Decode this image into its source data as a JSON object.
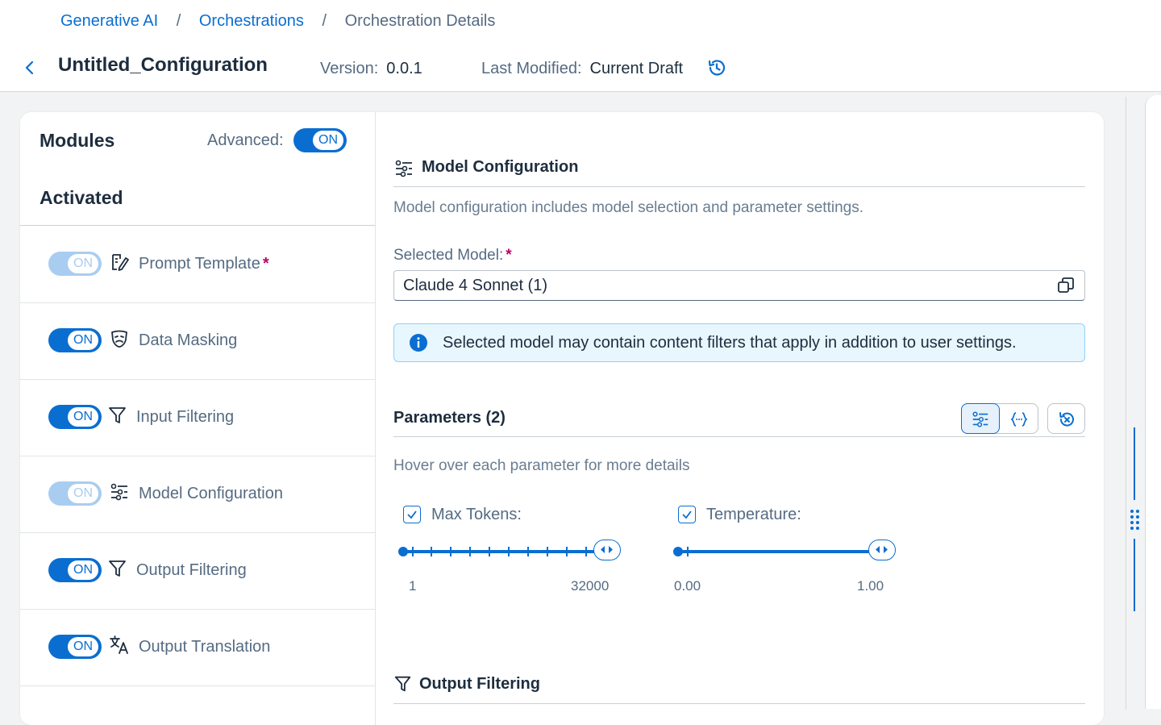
{
  "breadcrumb": {
    "items": [
      "Generative AI",
      "Orchestrations",
      "Orchestration Details"
    ],
    "separator": "/"
  },
  "header": {
    "title": "Untitled_Configuration",
    "version_label": "Version:",
    "version_value": "0.0.1",
    "modified_label": "Last Modified:",
    "modified_value": "Current Draft"
  },
  "modules": {
    "title": "Modules",
    "advanced_label": "Advanced:",
    "advanced_toggle": "ON",
    "activated_title": "Activated",
    "items": [
      {
        "label": "Prompt Template",
        "toggle": "ON",
        "required": "*",
        "disabled": true,
        "icon": "prompt-edit-icon"
      },
      {
        "label": "Data Masking",
        "toggle": "ON",
        "disabled": false,
        "icon": "mask-icon"
      },
      {
        "label": "Input Filtering",
        "toggle": "ON",
        "disabled": false,
        "icon": "filter-icon"
      },
      {
        "label": "Model Configuration",
        "toggle": "ON",
        "disabled": true,
        "icon": "sliders-icon"
      },
      {
        "label": "Output Filtering",
        "toggle": "ON",
        "disabled": false,
        "icon": "filter-icon"
      },
      {
        "label": "Output Translation",
        "toggle": "ON",
        "disabled": false,
        "icon": "translate-icon"
      }
    ]
  },
  "model_config": {
    "title": "Model Configuration",
    "description": "Model configuration includes model selection and parameter settings.",
    "selected_model_label": "Selected Model:",
    "required_mark": "*",
    "selected_model_value": "Claude 4 Sonnet (1)",
    "info_message": "Selected model may contain content filters that apply in addition to user settings."
  },
  "parameters": {
    "title": "Parameters (2)",
    "hint": "Hover over each parameter for more details",
    "items": [
      {
        "label": "Max Tokens:",
        "checked": true,
        "min": "1",
        "max": "32000",
        "value_fraction": 1.0
      },
      {
        "label": "Temperature:",
        "checked": true,
        "min": "0.00",
        "max": "1.00",
        "value_fraction": 1.0
      }
    ]
  },
  "output_filtering": {
    "title": "Output Filtering"
  },
  "colors": {
    "accent": "#0a6ed1",
    "required": "#c0006a",
    "info_bg": "#e8f6fd"
  }
}
